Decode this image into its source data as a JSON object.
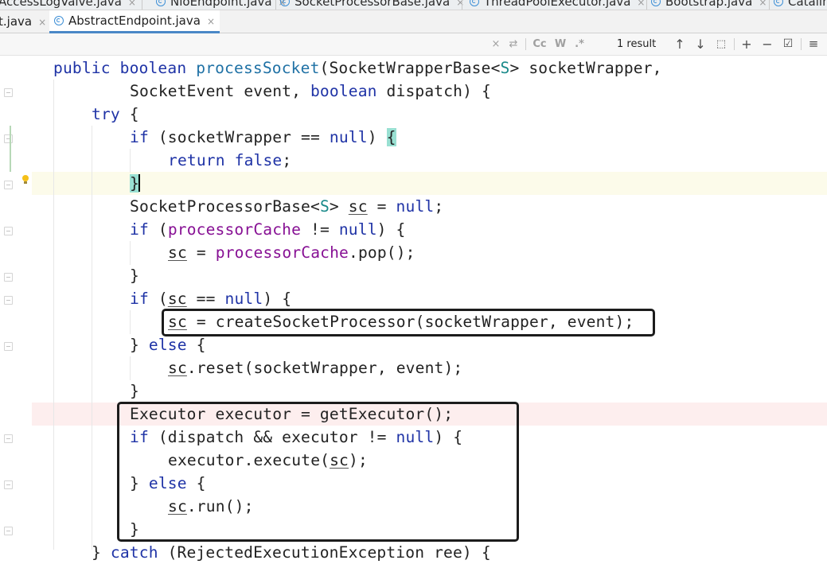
{
  "tabs_row1": [
    {
      "label": "AccessLogValve.java"
    },
    {
      "label": "NioEndpoint.java"
    },
    {
      "label": "SocketProcessorBase.java"
    },
    {
      "label": "ThreadPoolExecutor.java"
    },
    {
      "label": "Bootstrap.java"
    },
    {
      "label": "Catalin"
    }
  ],
  "tabs_row2": [
    {
      "label": "t.java"
    },
    {
      "label": "AbstractEndpoint.java",
      "active": true
    }
  ],
  "search": {
    "close_glyph": "×",
    "replace_glyph": "⇄",
    "match_case": "Cc",
    "words": "W",
    "regex": ".*",
    "result": "1 result",
    "prev_glyph": "↑",
    "next_glyph": "↓",
    "select_all_glyph": "⬚",
    "add_glyph": "+",
    "remove_glyph": "−",
    "check_glyph": "☑",
    "filter_glyph": "≡"
  },
  "code": {
    "lines": [
      "public boolean processSocket(SocketWrapperBase<S> socketWrapper,",
      "SocketEvent event, boolean dispatch) {",
      "try {",
      "if (socketWrapper == null) {",
      "return false;",
      "}",
      "SocketProcessorBase<S> sc = null;",
      "if (processorCache != null) {",
      "sc = processorCache.pop();",
      "}",
      "if (sc == null) {",
      "sc = createSocketProcessor(socketWrapper, event);",
      "} else {",
      "sc.reset(socketWrapper, event);",
      "}",
      "Executor executor = getExecutor();",
      "if (dispatch && executor != null) {",
      "executor.execute(sc);",
      "} else {",
      "sc.run();",
      "}",
      "} catch (RejectedExecutionException ree) {"
    ]
  },
  "colors": {
    "keyword": "#1f33a6",
    "method": "#1f71a5",
    "generic": "#1a8a8a",
    "field": "#871094",
    "brace_highlight": "#99e0d2",
    "error_line": "#fdeeee"
  }
}
